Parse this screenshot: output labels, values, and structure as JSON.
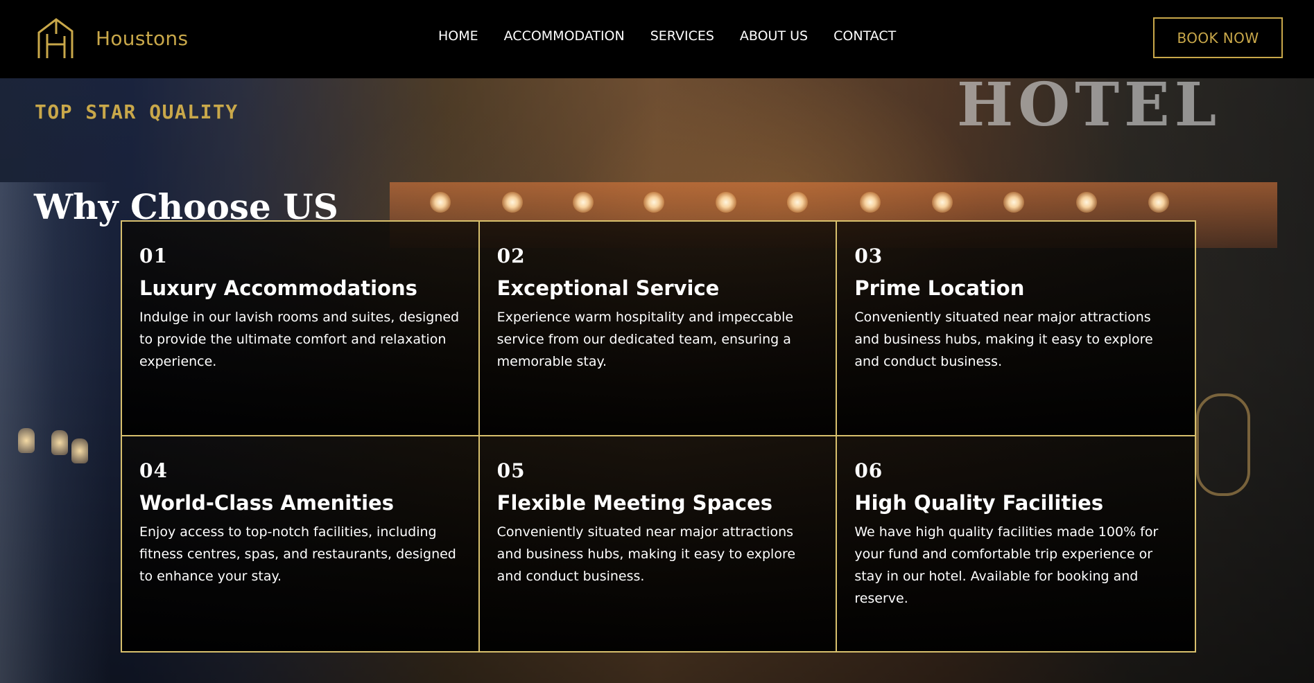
{
  "header": {
    "brand_name": "Houstons",
    "logo_icon": "house-h-logo-icon",
    "nav_items": [
      {
        "label": "HOME"
      },
      {
        "label": "ACCOMMODATION"
      },
      {
        "label": "SERVICES"
      },
      {
        "label": "ABOUT US"
      },
      {
        "label": "CONTACT"
      }
    ],
    "book_button": "BOOK NOW"
  },
  "hero": {
    "background_text": "HOTEL"
  },
  "section": {
    "kicker": "TOP STAR QUALITY",
    "title": "Why Choose US",
    "cards": [
      {
        "number": "01",
        "title": "Luxury Accommodations",
        "text": "Indulge in our lavish rooms and suites, designed to provide the ultimate comfort and relaxation experience."
      },
      {
        "number": "02",
        "title": "Exceptional Service",
        "text": "Experience warm hospitality and impeccable service from our dedicated team, ensuring a memorable stay."
      },
      {
        "number": "03",
        "title": "Prime Location",
        "text": "Conveniently situated near major attractions and business hubs, making it easy to explore and conduct business."
      },
      {
        "number": "04",
        "title": "World-Class Amenities",
        "text": "Enjoy access to top-notch facilities, including fitness centres, spas, and restaurants, designed to enhance your stay."
      },
      {
        "number": "05",
        "title": "Flexible Meeting Spaces",
        "text": "Conveniently situated near major attractions and business hubs, making it easy to explore and conduct business."
      },
      {
        "number": "06",
        "title": "High Quality Facilities",
        "text": "We have high quality facilities made 100% for your fund and comfortable trip experience or stay in our hotel. Available for booking and reserve."
      }
    ]
  },
  "colors": {
    "brand_gold": "#c9a84a",
    "line_gold": "#d8c06d",
    "background": "#000000",
    "text_white": "#ffffff"
  }
}
